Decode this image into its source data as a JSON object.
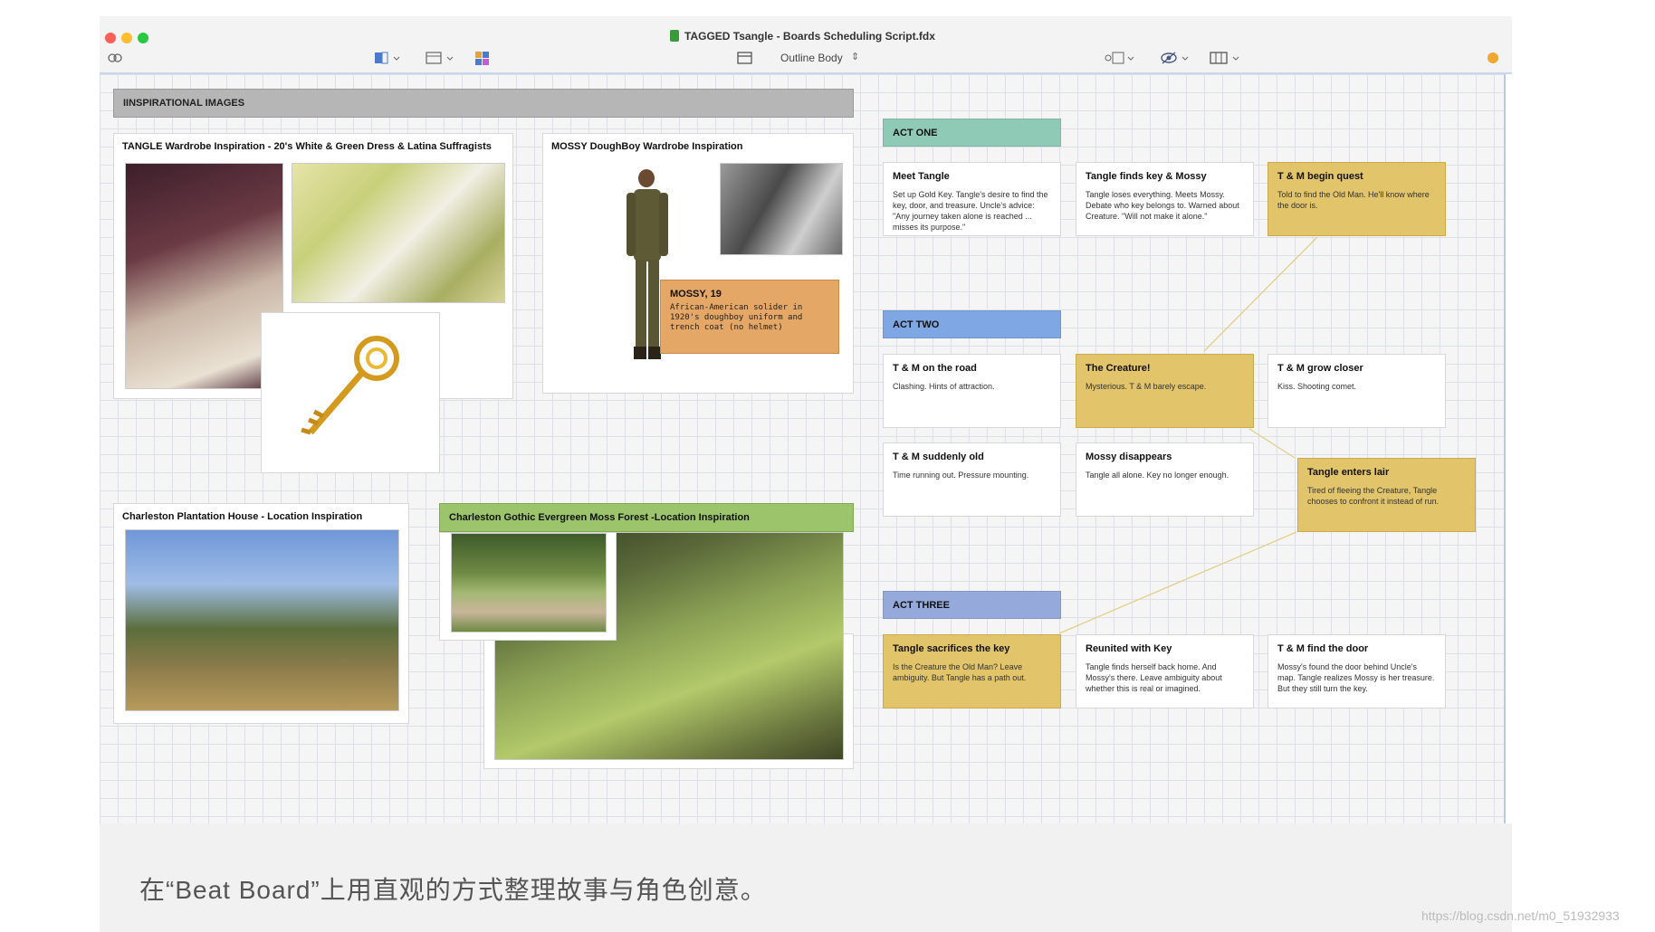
{
  "window": {
    "title": "TAGGED Tsangle - Boards Scheduling Script.fdx",
    "traffic_lights": [
      "#ff5f57",
      "#febc2e",
      "#28c840"
    ]
  },
  "toolbar": {
    "style_select": "Outline Body",
    "icons": [
      "collaborators-icon",
      "add-card-icon",
      "view-layout-icon",
      "board-color-icon",
      "outline-icon",
      "shape-toggle-icon",
      "visibility-icon",
      "columns-icon",
      "notification-dot-icon"
    ]
  },
  "board": {
    "inspirational_header": "IINSPIRATIONAL IMAGES",
    "cards": {
      "tangle_wardrobe": "TANGLE Wardrobe Inspiration - 20's White & Green Dress & Latina Suffragists",
      "mossy_wardrobe": "MOSSY DoughBoy Wardrobe Inspiration",
      "charleston_house": "Charleston Plantation House - Location Inspiration",
      "charleston_forest": "Charleston  Gothic Evergreen Moss Forest -Location Inspiration"
    },
    "mossy_note": {
      "title": "MOSSY, 19",
      "body": "African-American solider in 1920's doughboy uniform and trench coat (no helmet)"
    },
    "acts": [
      {
        "label": "ACT ONE",
        "color": "#8fcab6"
      },
      {
        "label": "ACT TWO",
        "color": "#7ea7e3"
      },
      {
        "label": "ACT THREE",
        "color": "#95a9db"
      }
    ],
    "beats": {
      "meet_tangle": {
        "title": "Meet Tangle",
        "body": "Set up Gold Key. Tangle's desire to find the key, door, and treasure. Uncle's advice: \"Any journey taken alone is reached ... misses its purpose.\""
      },
      "tangle_finds_key": {
        "title": "Tangle finds key & Mossy",
        "body": "Tangle loses everything. Meets Mossy. Debate who key belongs to. Warned about Creature. \"Will not make it alone.\""
      },
      "tm_begin_quest": {
        "title": "T & M begin quest",
        "body": "Told to find the Old Man. He'll know where the door is."
      },
      "tm_on_road": {
        "title": "T & M on the road",
        "body": "Clashing. Hints of attraction."
      },
      "the_creature": {
        "title": "The Creature!",
        "body": "Mysterious. T & M barely escape."
      },
      "tm_grow_closer": {
        "title": "T & M grow closer",
        "body": "Kiss. Shooting comet."
      },
      "tm_suddenly_old": {
        "title": "T & M suddenly old",
        "body": "Time running out. Pressure mounting."
      },
      "mossy_disappears": {
        "title": "Mossy disappears",
        "body": "Tangle all alone. Key no longer enough."
      },
      "tangle_enters_lair": {
        "title": "Tangle enters lair",
        "body": "Tired of fleeing the Creature, Tangle chooses to confront it instead of run."
      },
      "tangle_sacrifices": {
        "title": "Tangle sacrifices the key",
        "body": "Is the Creature the Old Man? Leave ambiguity. But Tangle has a path out."
      },
      "reunited": {
        "title": "Reunited with Key",
        "body": "Tangle finds herself back home. And Mossy's there. Leave ambiguity about whether this is real or imagined."
      },
      "tm_find_door": {
        "title": "T & M find the door",
        "body": "Mossy's found the door behind Uncle's map. Tangle realizes Mossy is her treasure. But they still turn the key."
      }
    }
  },
  "caption": "在“Beat Board”上用直观的方式整理故事与角色创意。",
  "credit": "https://blog.csdn.net/m0_51932933",
  "colors": {
    "header_gray": "#b6b6b6",
    "forest_header_green": "#9cc46b",
    "beat_yellow": "#e2c46b",
    "note_orange": "#e5a766"
  }
}
